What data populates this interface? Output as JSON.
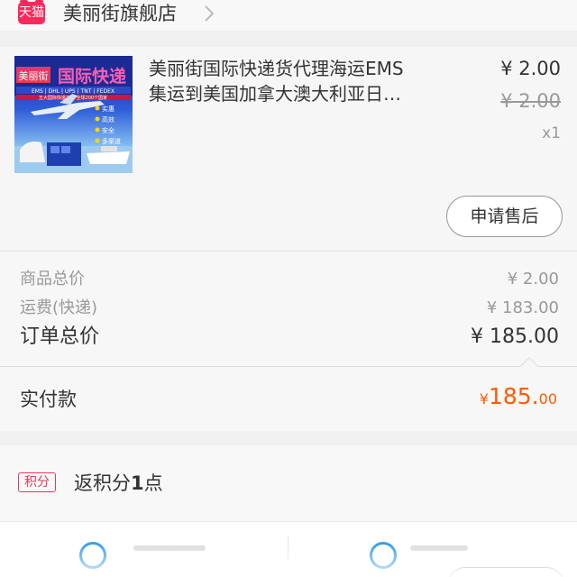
{
  "store": {
    "badge_label": "天猫",
    "name": "美丽街旗舰店",
    "chevron_icon": "chevron-right-icon"
  },
  "product": {
    "title_line1": "美丽街国际快递货代理海运EMS",
    "title_line2": "集运到美国加拿大澳大利亚日…",
    "price": "¥ 2.00",
    "original_price": "¥ 2.00",
    "quantity": "x1",
    "aftersale_label": "申请售后",
    "thumb": {
      "brand_text": "美丽街",
      "banner_text": "国际快递",
      "carriers": "EMS | DHL | UPS | TNT | FEDEX",
      "tagline": "五大国际快递方式 全球200个国家",
      "features": [
        "实惠",
        "高效",
        "安全",
        "多渠道"
      ]
    }
  },
  "summary": {
    "goods_total_label": "商品总价",
    "goods_total_value": "¥ 2.00",
    "shipping_label": "运费(快递)",
    "shipping_value": "¥ 183.00",
    "order_total_label": "订单总价",
    "order_total_value": "¥ 185.00"
  },
  "payment": {
    "label": "实付款",
    "currency": "¥",
    "amount_int": "185.",
    "amount_dec": "00",
    "accent_color": "#ff5a00"
  },
  "points": {
    "badge_label": "积分",
    "text_prefix": "返积分",
    "count": "1",
    "text_suffix": "点",
    "accent_color": "#e8385e"
  },
  "colors": {
    "tmall_red": "#ff2a5b",
    "bottom_icon_blue": "#3aa0e8"
  }
}
